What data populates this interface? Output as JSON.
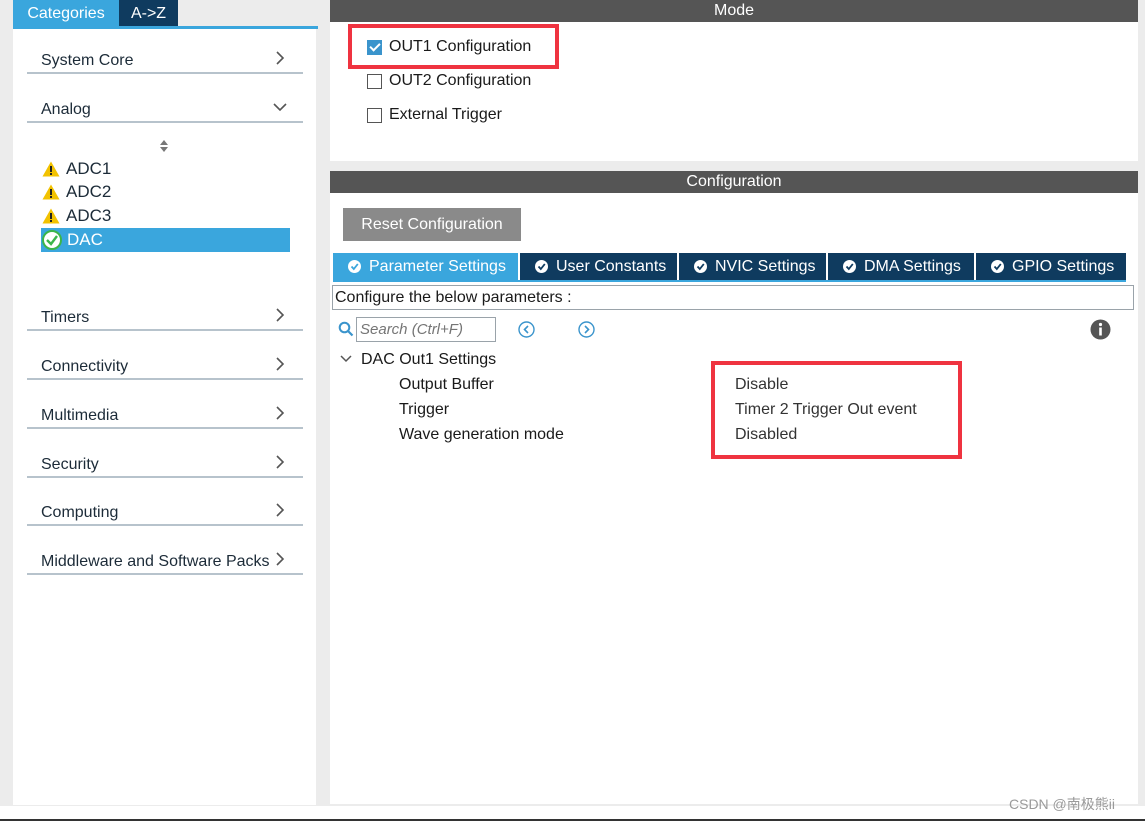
{
  "left_panel": {
    "tabs": [
      {
        "label": "Categories",
        "active": true
      },
      {
        "label": "A->Z",
        "active": false
      }
    ],
    "categories": [
      {
        "label": "System Core",
        "expanded": false
      },
      {
        "label": "Analog",
        "expanded": true
      },
      {
        "label": "Timers",
        "expanded": false
      },
      {
        "label": "Connectivity",
        "expanded": false
      },
      {
        "label": "Multimedia",
        "expanded": false
      },
      {
        "label": "Security",
        "expanded": false
      },
      {
        "label": "Computing",
        "expanded": false
      },
      {
        "label": "Middleware and Software Packs",
        "expanded": false
      }
    ],
    "analog_items": [
      {
        "label": "ADC1",
        "status": "warning"
      },
      {
        "label": "ADC2",
        "status": "warning"
      },
      {
        "label": "ADC3",
        "status": "warning"
      },
      {
        "label": "DAC",
        "status": "ok",
        "selected": true
      }
    ]
  },
  "mode": {
    "title": "Mode",
    "options": [
      {
        "label": "OUT1 Configuration",
        "checked": true
      },
      {
        "label": "OUT2 Configuration",
        "checked": false
      },
      {
        "label": "External Trigger",
        "checked": false
      }
    ]
  },
  "configuration": {
    "title": "Configuration",
    "reset_label": "Reset Configuration",
    "tabs": [
      {
        "label": "Parameter Settings",
        "active": true
      },
      {
        "label": "User Constants",
        "active": false
      },
      {
        "label": "NVIC Settings",
        "active": false
      },
      {
        "label": "DMA Settings",
        "active": false
      },
      {
        "label": "GPIO Settings",
        "active": false
      }
    ],
    "description": "Configure the below parameters :",
    "search_placeholder": "Search (Ctrl+F)",
    "group": {
      "title": "DAC Out1 Settings",
      "params": [
        {
          "name": "Output Buffer",
          "value": "Disable"
        },
        {
          "name": "Trigger",
          "value": "Timer 2 Trigger Out event"
        },
        {
          "name": "Wave generation mode",
          "value": "Disabled"
        }
      ]
    }
  },
  "watermark": "CSDN @南极熊ii",
  "colors": {
    "accent": "#3aa6dd",
    "dark_tab": "#0f3b5f",
    "header": "#555555",
    "highlight_box": "#ef3340"
  }
}
